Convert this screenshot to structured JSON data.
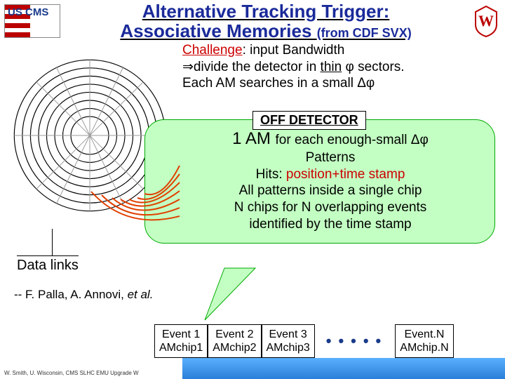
{
  "header": {
    "logo_left_text": "US CMS",
    "title_line1": "Alternative Tracking Trigger:",
    "title_line2_main": "Associative Memories",
    "title_line2_small": "(from CDF SVX)"
  },
  "challenge": {
    "word": "Challenge",
    "rest1": ": input Bandwidth",
    "line2_arrow": "⇒",
    "line2a": "divide the detector in ",
    "line2_u": "thin",
    "line2b": " φ sectors.",
    "line3": "Each AM searches in a small Δφ"
  },
  "off_detector_label": "OFF DETECTOR",
  "green_box": {
    "l1a": "1 AM ",
    "l1b": "for each enough-small Δφ",
    "l2": "Patterns",
    "l3a": "Hits: ",
    "l3b": "position+time stamp",
    "l4": "All patterns inside a single chip",
    "l5": "N chips for N overlapping events",
    "l6": "identified by the time stamp"
  },
  "data_links_label": "Data links",
  "credit": {
    "prefix": "-- F. Palla, A. Annovi, ",
    "etal": "et al."
  },
  "events": [
    {
      "top": "Event 1",
      "bot": "AMchip1"
    },
    {
      "top": "Event 2",
      "bot": "AMchip2"
    },
    {
      "top": "Event 3",
      "bot": "AMchip3"
    }
  ],
  "events_dots": "•••••",
  "event_n": {
    "top": "Event.N",
    "bot": "AMchip.N"
  },
  "footer": "W. Smith, U. Wisconsin, CMS SLHC EMU Upgrade W"
}
